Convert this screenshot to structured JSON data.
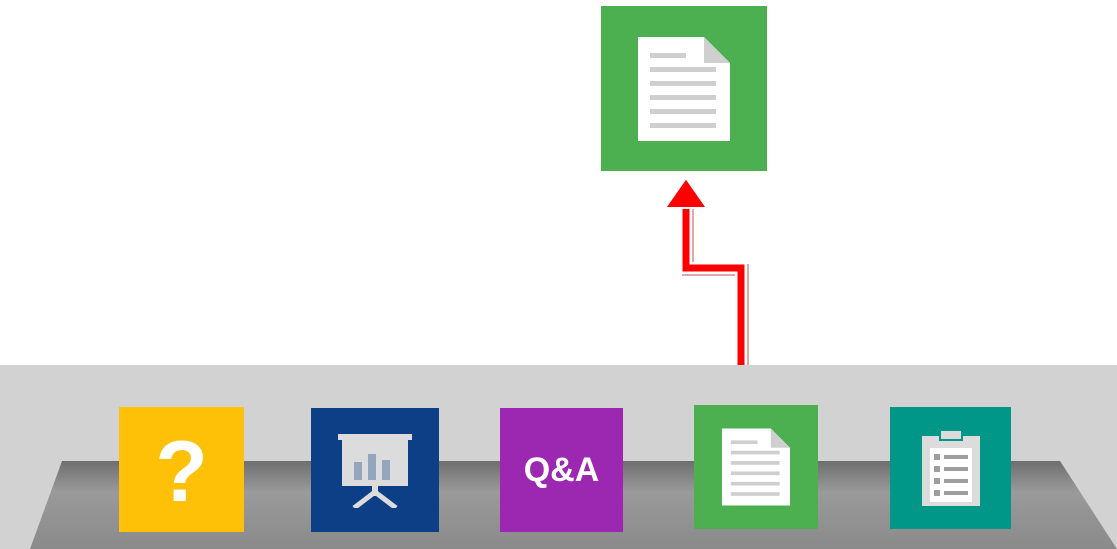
{
  "colors": {
    "help_tile": "#FFC107",
    "presentation_tile": "#0D3F87",
    "qa_tile": "#9C27B0",
    "document_tile": "#4CAF50",
    "clipboard_tile": "#009688",
    "arrow": "#FF0000",
    "dock_top": "#D0D0D0",
    "dock_shelf": "#8A8A8A"
  },
  "floating_tile": {
    "icon": "document-icon"
  },
  "dock": {
    "items": [
      {
        "id": "help",
        "icon": "question-mark-icon",
        "label": "?"
      },
      {
        "id": "presentation",
        "icon": "presentation-board-icon"
      },
      {
        "id": "qa",
        "icon": "qa-icon",
        "label": "Q&A"
      },
      {
        "id": "document",
        "icon": "document-icon"
      },
      {
        "id": "clipboard",
        "icon": "clipboard-list-icon"
      }
    ]
  }
}
